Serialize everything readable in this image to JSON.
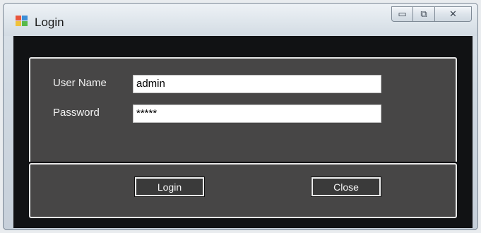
{
  "window": {
    "title": "Login",
    "caption_buttons": {
      "minimize": "▭",
      "maximize": "⧉",
      "close": "✕"
    }
  },
  "form": {
    "username_label": "User Name",
    "username_value": "admin",
    "password_label": "Password",
    "password_value": "*****"
  },
  "buttons": {
    "login_label": "Login",
    "close_label": "Close"
  },
  "colors": {
    "client_bg": "#111214",
    "panel_bg": "#474646",
    "panel_border": "#e6e6e6",
    "label_text": "#f2f2f2"
  }
}
